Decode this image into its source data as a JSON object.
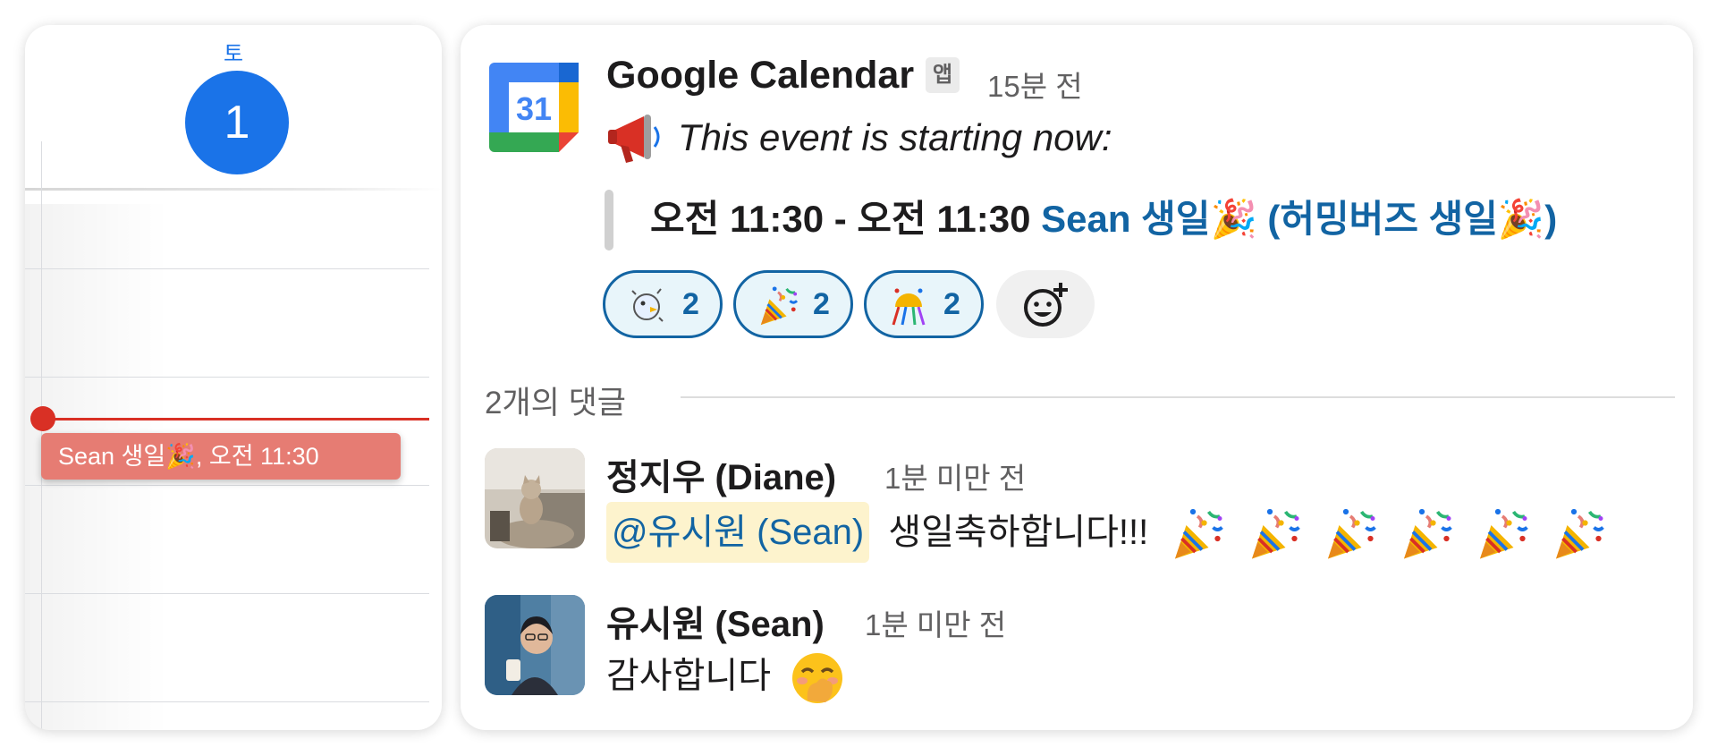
{
  "calendar": {
    "day_of_week": "토",
    "date": "1",
    "event_label": "Sean 생일🎉, 오전 11:30",
    "event_color": "#e67c73",
    "accent_color": "#1a73e8",
    "now_line_color": "#d93025"
  },
  "message": {
    "app_icon": "google-calendar-icon",
    "app_name": "Google Calendar",
    "app_badge": "앱",
    "timestamp": "15분 전",
    "intro_icon": "megaphone-icon",
    "intro_text": "This event is starting now:",
    "event_time": "오전 11:30 - 오전 11:30",
    "event_title": "Sean 생일🎉 (허밍버즈 생일🎉)",
    "reactions": [
      {
        "emoji": "party-parrot-icon",
        "count": "2"
      },
      {
        "emoji": "party-popper-icon",
        "count": "2"
      },
      {
        "emoji": "confetti-ball-icon",
        "count": "2"
      }
    ],
    "add_reaction_icon": "add-reaction-icon",
    "link_color": "#1264a3"
  },
  "thread": {
    "replies_label": "2개의 댓글",
    "replies": [
      {
        "author": "정지우 (Diane)",
        "time": "1분 미만 전",
        "mention": "@유시원 (Sean)",
        "text": "생일축하합니다!!!",
        "emoji_trail": [
          "party-popper-icon",
          "party-popper-icon",
          "party-popper-icon",
          "party-popper-icon",
          "party-popper-icon",
          "party-popper-icon"
        ]
      },
      {
        "author": "유시원 (Sean)",
        "time": "1분 미만 전",
        "text": "감사합니다",
        "emoji_trail": [
          "hand-over-mouth-icon"
        ]
      }
    ]
  }
}
